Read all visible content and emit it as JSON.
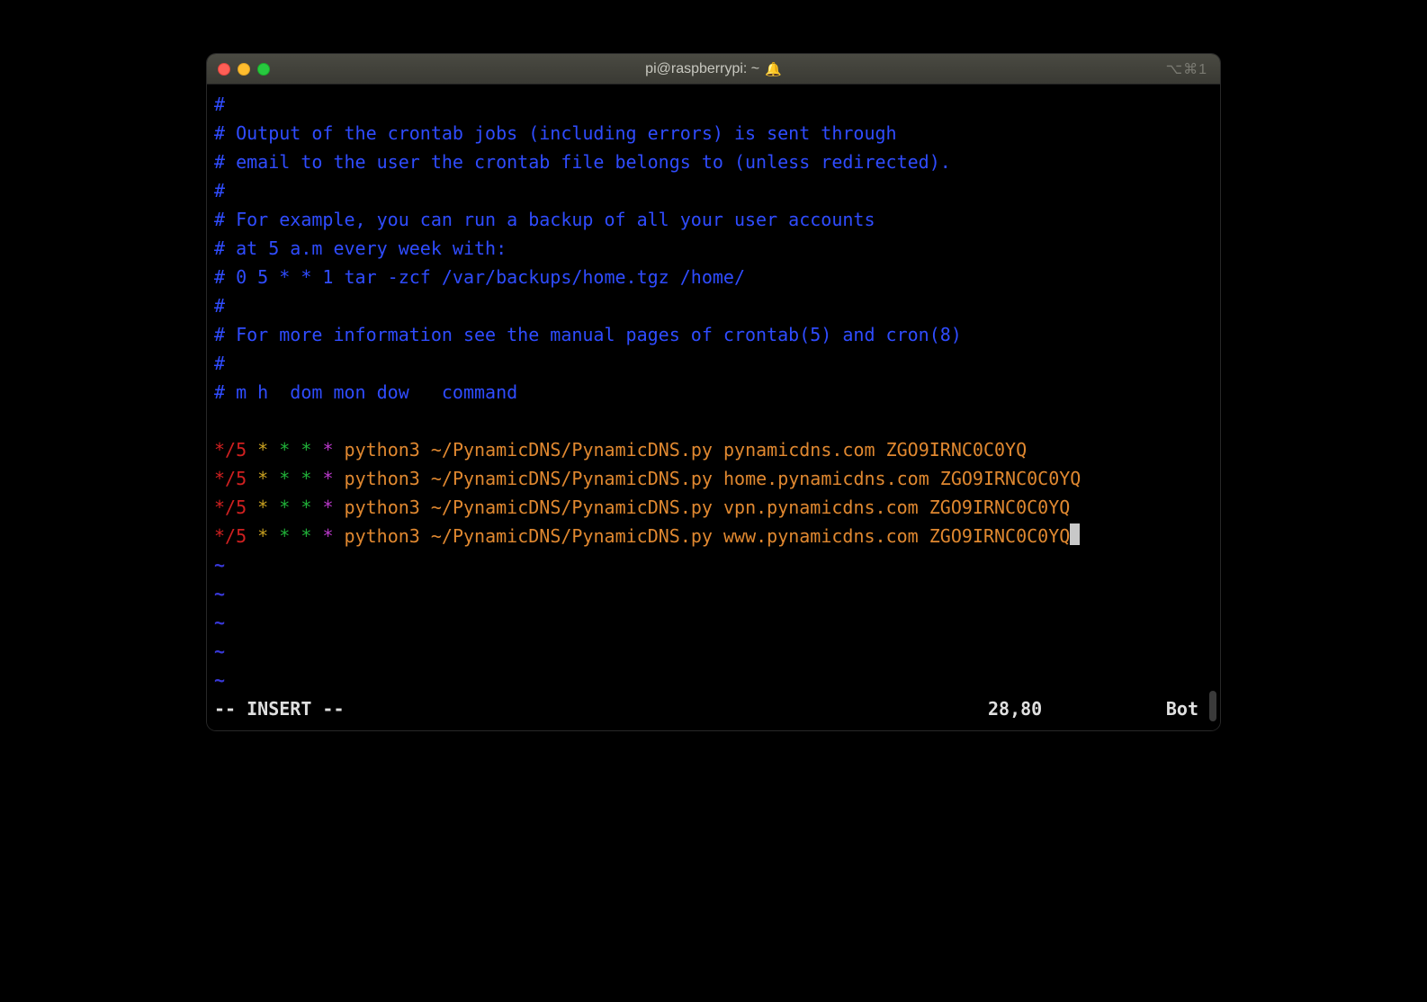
{
  "window": {
    "title": "pi@raspberrypi: ~",
    "bell_glyph": "🔔",
    "shortcut_glyph": "⌥⌘1"
  },
  "comments": [
    "#",
    "# Output of the crontab jobs (including errors) is sent through",
    "# email to the user the crontab file belongs to (unless redirected).",
    "#",
    "# For example, you can run a backup of all your user accounts",
    "# at 5 a.m every week with:",
    "# 0 5 * * 1 tar -zcf /var/backups/home.tgz /home/",
    "#",
    "# For more information see the manual pages of crontab(5) and cron(8)",
    "#",
    "# m h  dom mon dow   command"
  ],
  "cron": [
    {
      "min": "*/5",
      "h": "*",
      "dom": "*",
      "mon": "*",
      "dow": "*",
      "cmd": "python3 ~/PynamicDNS/PynamicDNS.py pynamicdns.com ZGO9IRNC0C0YQ"
    },
    {
      "min": "*/5",
      "h": "*",
      "dom": "*",
      "mon": "*",
      "dow": "*",
      "cmd": "python3 ~/PynamicDNS/PynamicDNS.py home.pynamicdns.com ZGO9IRNC0C0YQ"
    },
    {
      "min": "*/5",
      "h": "*",
      "dom": "*",
      "mon": "*",
      "dow": "*",
      "cmd": "python3 ~/PynamicDNS/PynamicDNS.py vpn.pynamicdns.com ZGO9IRNC0C0YQ"
    },
    {
      "min": "*/5",
      "h": "*",
      "dom": "*",
      "mon": "*",
      "dow": "*",
      "cmd": "python3 ~/PynamicDNS/PynamicDNS.py www.pynamicdns.com ZGO9IRNC0C0YQ"
    }
  ],
  "tildes": [
    "~",
    "~",
    "~",
    "~",
    "~"
  ],
  "status": {
    "mode": "-- INSERT --",
    "position": "28,80",
    "scroll": "Bot"
  }
}
